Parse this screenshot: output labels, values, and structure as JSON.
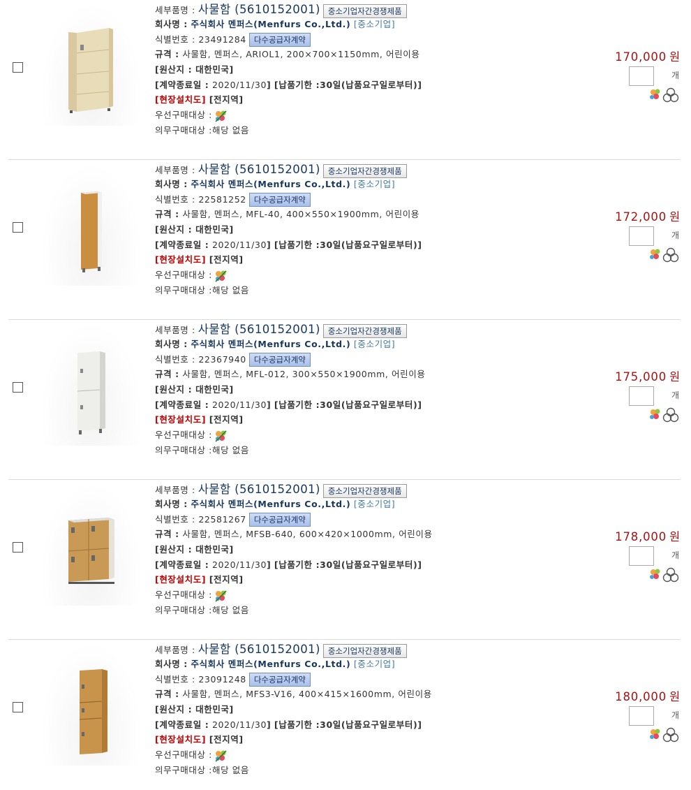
{
  "labels": {
    "detail_name": "세부품명 :",
    "company": "회사명 :",
    "id": "식별번호 :",
    "spec": "규격 :",
    "origin": "[원산지 : 대한민국]",
    "contract": "[계약종료일 :",
    "contract_close": "]",
    "delivery": "[납품기한 :30일(납품요구일로부터)]",
    "install": "[현장설치도]",
    "install_area": "[전지역]",
    "priority": "우선구매대상 :",
    "mandatory": "의무구매대상 :",
    "mandatory_value": "해당 없음",
    "unit": "개",
    "won": "원",
    "sme_tag": "중소기업자간경쟁제품",
    "mas_tag": "다수공급자계약",
    "sme_company": "[중소기업]"
  },
  "items": [
    {
      "name": "사물함 (5610152001)",
      "company": "주식회사 멘퍼스(Menfurs Co.,Ltd.)",
      "id": "23491284",
      "spec": "사물함, 멘퍼스, ARIOL1, 200×700×1150mm, 어린이용",
      "contract_end": "2020/11/30",
      "price": "170,000",
      "image": "bookshelf-locker"
    },
    {
      "name": "사물함 (5610152001)",
      "company": "주식회사 멘퍼스(Menfurs Co.,Ltd.)",
      "id": "22581252",
      "spec": "사물함, 멘퍼스, MFL-40, 400×550×1900mm, 어린이용",
      "contract_end": "2020/11/30",
      "price": "172,000",
      "image": "tall-single-locker"
    },
    {
      "name": "사물함 (5610152001)",
      "company": "주식회사 멘퍼스(Menfurs Co.,Ltd.)",
      "id": "22367940",
      "spec": "사물함, 멘퍼스, MFL-012, 300×550×1900mm, 어린이용",
      "contract_end": "2020/11/30",
      "price": "175,000",
      "image": "white-two-door-locker"
    },
    {
      "name": "사물함 (5610152001)",
      "company": "주식회사 멘퍼스(Menfurs Co.,Ltd.)",
      "id": "22581267",
      "spec": "사물함, 멘퍼스, MFSB-640, 600×420×1000mm, 어린이용",
      "contract_end": "2020/11/30",
      "price": "178,000",
      "image": "four-door-locker"
    },
    {
      "name": "사물함 (5610152001)",
      "company": "주식회사 멘퍼스(Menfurs Co.,Ltd.)",
      "id": "23091248",
      "spec": "사물함, 멘퍼스, MFS3-V16, 400×415×1600mm, 어린이용",
      "contract_end": "2020/11/30",
      "price": "180,000",
      "image": "three-door-locker"
    }
  ]
}
